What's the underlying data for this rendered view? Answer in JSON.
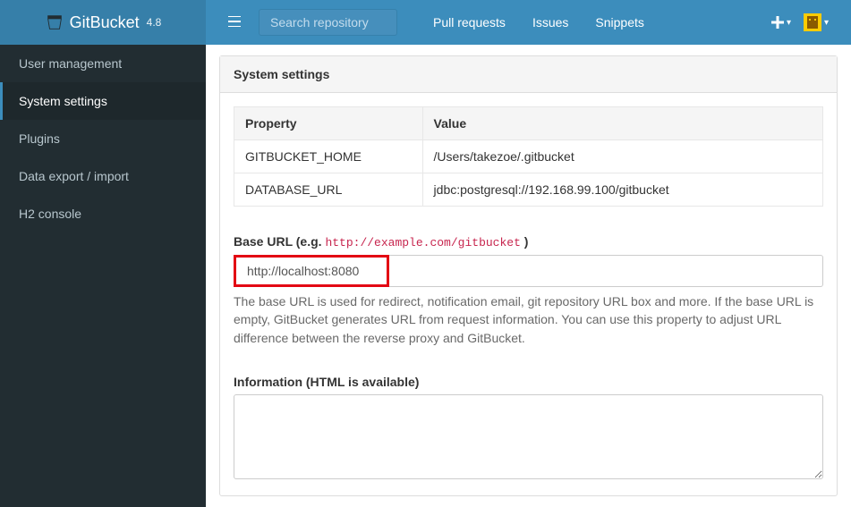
{
  "brand": {
    "name": "GitBucket",
    "version": "4.8"
  },
  "topnav": {
    "search_placeholder": "Search repository",
    "links": {
      "pull_requests": "Pull requests",
      "issues": "Issues",
      "snippets": "Snippets"
    }
  },
  "sidebar": {
    "items": [
      {
        "label": "User management"
      },
      {
        "label": "System settings"
      },
      {
        "label": "Plugins"
      },
      {
        "label": "Data export / import"
      },
      {
        "label": "H2 console"
      }
    ]
  },
  "panel": {
    "heading": "System settings"
  },
  "props": {
    "headers": {
      "property": "Property",
      "value": "Value"
    },
    "rows": [
      {
        "property": "GITBUCKET_HOME",
        "value": "/Users/takezoe/.gitbucket"
      },
      {
        "property": "DATABASE_URL",
        "value": "jdbc:postgresql://192.168.99.100/gitbucket"
      }
    ]
  },
  "base_url": {
    "label_prefix": "Base URL (e.g. ",
    "example": "http://example.com/gitbucket",
    "label_suffix": " )",
    "value": "http://localhost:8080",
    "help": "The base URL is used for redirect, notification email, git repository URL box and more. If the base URL is empty, GitBucket generates URL from request information. You can use this property to adjust URL difference between the reverse proxy and GitBucket."
  },
  "information": {
    "label": "Information (HTML is available)",
    "value": ""
  }
}
